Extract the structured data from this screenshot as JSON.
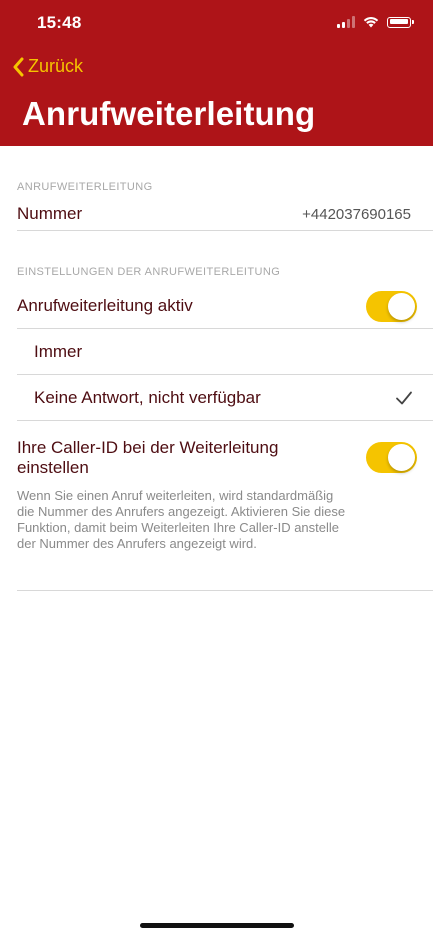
{
  "status_bar": {
    "time": "15:48"
  },
  "nav": {
    "back_label": "Zurück",
    "title": "Anrufweiterleitung"
  },
  "section_number": {
    "header": "ANRUFWEITERLEITUNG",
    "row_label": "Nummer",
    "row_value": "+442037690165"
  },
  "section_settings": {
    "header": "EINSTELLUNGEN DER ANRUFWEITERLEITUNG",
    "active_label": "Anrufweiterleitung aktiv",
    "active_on": true,
    "options": [
      {
        "label": "Immer",
        "selected": false
      },
      {
        "label": "Keine Antwort, nicht verfügbar",
        "selected": true
      }
    ],
    "caller_id_label": "Ihre Caller-ID bei der Weiterleitung einstellen",
    "caller_id_on": true,
    "caller_id_description": "Wenn Sie einen Anruf weiterleiten, wird standardmäßig die Nummer des Anrufers angezeigt. Aktivieren Sie diese Funktion, damit beim Weiterleiten Ihre Caller-ID anstelle der Nummer des Anrufers angezeigt wird."
  },
  "colors": {
    "header_bg": "#ae1418",
    "accent_yellow": "#f5c400",
    "label_text": "#4e0d12"
  },
  "icons": {
    "back": "chevron-left-icon",
    "selected": "checkmark-icon",
    "signal": "cellular-signal-icon",
    "wifi": "wifi-icon",
    "battery": "battery-icon"
  }
}
